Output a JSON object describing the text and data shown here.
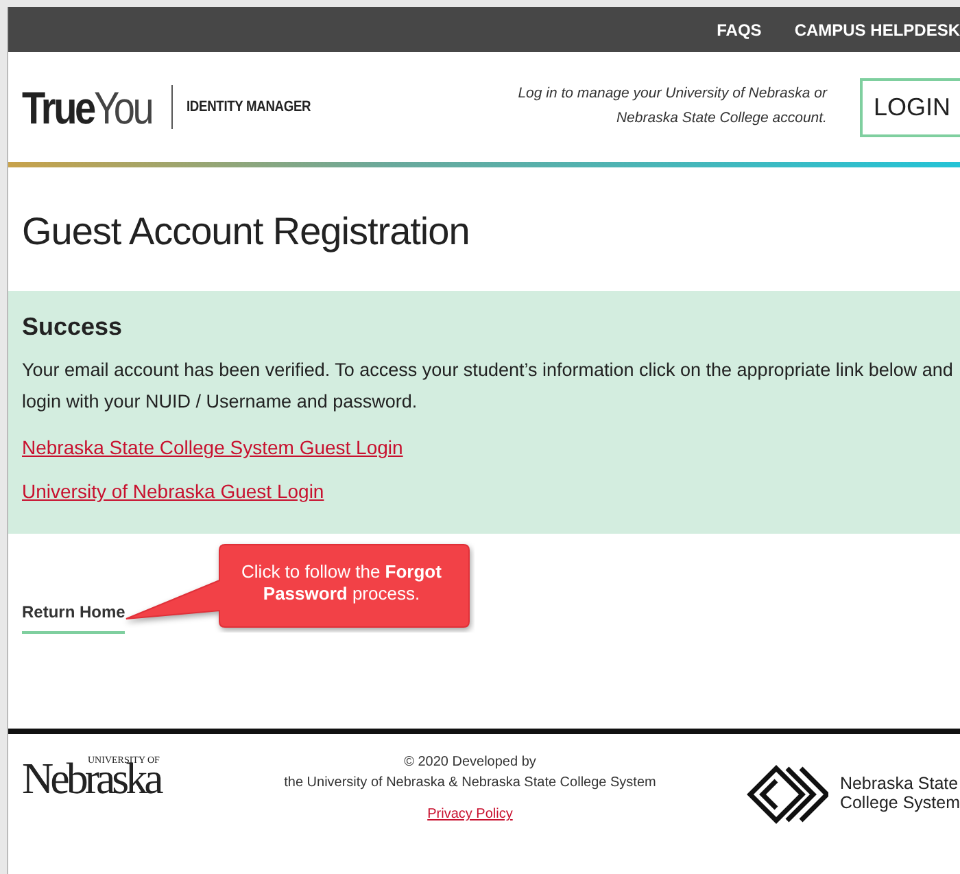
{
  "top_nav": {
    "links": [
      "FAQS",
      "CAMPUS HELPDESK"
    ]
  },
  "header": {
    "logo": {
      "bold": "True",
      "light": "You"
    },
    "subtitle": "IDENTITY MANAGER",
    "login_note": [
      "Log in to manage your University of Nebraska or",
      "Nebraska State College account."
    ],
    "login_button": "LOGIN"
  },
  "page_title": "Guest Account Registration",
  "alert": {
    "title": "Success",
    "message": "Your email account has been verified. To access your student’s information click on the appropriate link below and login with your NUID / Username and password.",
    "links": [
      "Nebraska State College System Guest Login",
      "University of Nebraska Guest Login"
    ]
  },
  "return_link": "Return Home",
  "callout": "Click to follow the **Forgot Password** process.",
  "footer": {
    "unl_logo": {
      "small": "UNIVERSITY OF",
      "big": "Nebraska"
    },
    "credit": [
      "© 2020 Developed by",
      "the University of Nebraska & Nebraska State College System"
    ],
    "privacy_link": "Privacy Policy",
    "nscs_logo": [
      "Nebraska State",
      "College System"
    ]
  }
}
